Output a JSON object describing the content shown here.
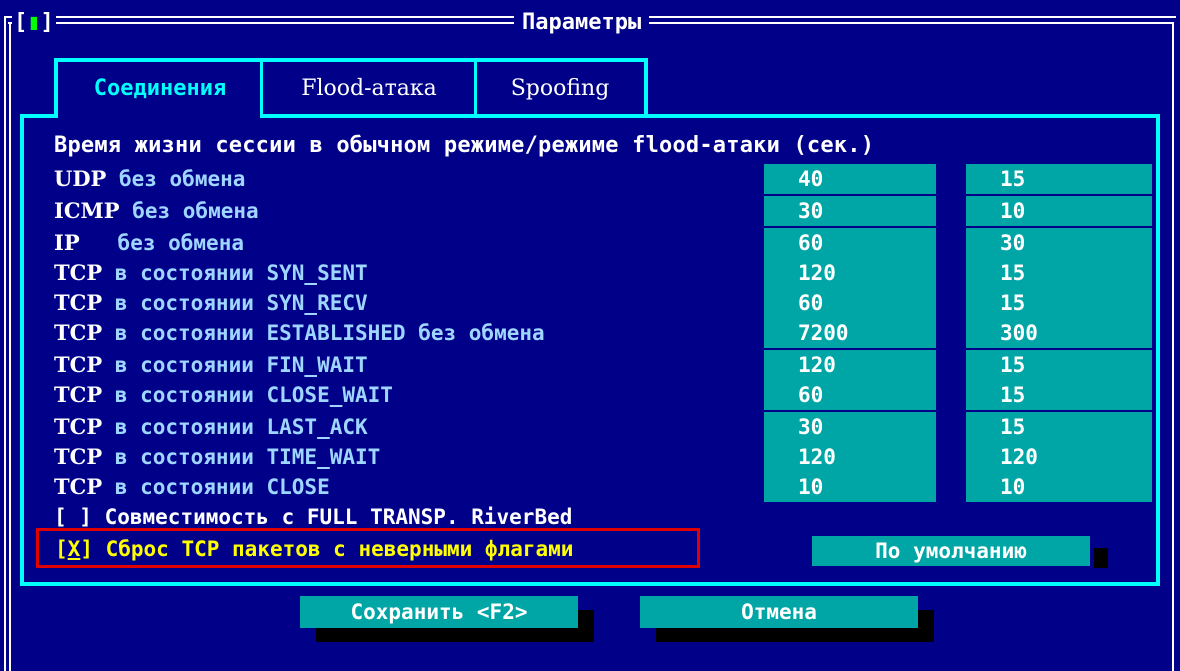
{
  "window": {
    "title": "Параметры",
    "close_box": [
      "[",
      "▮",
      "]"
    ]
  },
  "tabs": [
    {
      "label": "Соединения",
      "active": true
    },
    {
      "label": "Flood-атака",
      "active": false
    },
    {
      "label": "Spoofing",
      "active": false
    }
  ],
  "section_header": "Время жизни сессии в обычном режиме/режиме flood-атаки (сек.)",
  "rows": [
    {
      "proto": "UDP",
      "label": " без обмена",
      "normal": "40",
      "flood": "15"
    },
    {
      "proto": "ICMP",
      "label": " без обмена",
      "normal": "30",
      "flood": "10"
    },
    {
      "proto": "IP",
      "label": "   без обмена",
      "normal": "60",
      "flood": "30"
    },
    {
      "proto": "TCP",
      "label": " в состоянии SYN_SENT",
      "normal": "120",
      "flood": "15"
    },
    {
      "proto": "TCP",
      "label": " в состоянии SYN_RECV",
      "normal": "60",
      "flood": "15"
    },
    {
      "proto": "TCP",
      "label": " в состоянии ESTABLISHED без обмена",
      "normal": "7200",
      "flood": "300"
    },
    {
      "proto": "TCP",
      "label": " в состоянии FIN_WAIT",
      "normal": "120",
      "flood": "15"
    },
    {
      "proto": "TCP",
      "label": " в состоянии CLOSE_WAIT",
      "normal": "60",
      "flood": "15"
    },
    {
      "proto": "TCP",
      "label": " в состоянии LAST_ACK",
      "normal": "30",
      "flood": "15"
    },
    {
      "proto": "TCP",
      "label": " в состоянии TIME_WAIT",
      "normal": "120",
      "flood": "120"
    },
    {
      "proto": "TCP",
      "label": " в состоянии CLOSE",
      "normal": "10",
      "flood": "10"
    }
  ],
  "checkboxes": {
    "compat": {
      "mark": "[ ]",
      "label": " Совместимость с FULL TRANSP. RiverBed"
    },
    "reset": {
      "open": "[",
      "mark": "X",
      "close": "]",
      "label": " Сброс TCP пакетов с неверными флагами"
    }
  },
  "buttons": {
    "default": "По умолчанию",
    "save": "Сохранить <F2>",
    "cancel": "Отмена"
  },
  "colors": {
    "background": "#000088",
    "field": "#00a6a6",
    "highlight": "#ffff00",
    "focus_frame": "#e00000"
  }
}
